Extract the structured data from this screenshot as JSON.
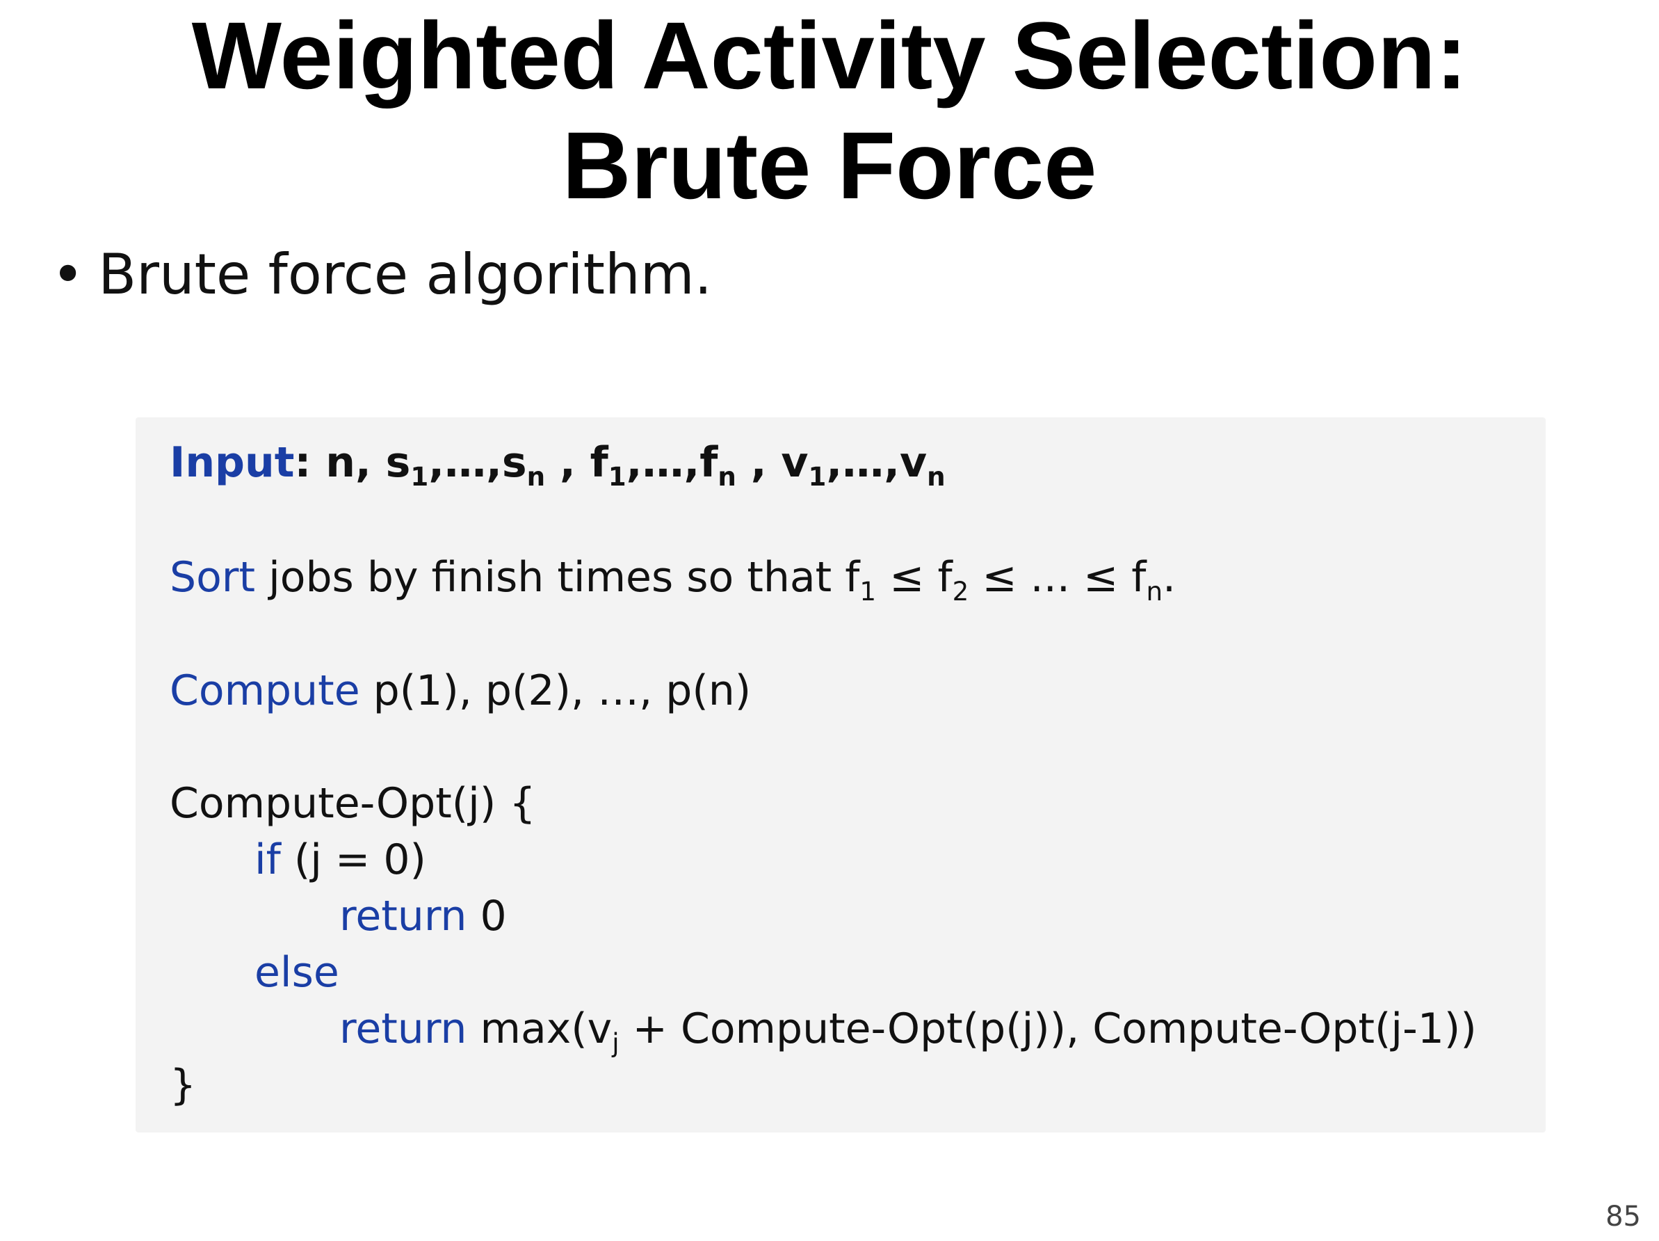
{
  "slide": {
    "title_line1": "Weighted Activity Selection:",
    "title_line2": "Brute Force",
    "bullet": "Brute force algorithm.",
    "page_number": "85"
  },
  "code": {
    "input_kw": "Input",
    "input_colon": ": n, s",
    "input_vars": {
      "s_first_sub": "1",
      "s_mid": ",…,s",
      "s_last_sub": "n",
      "sep1": " , f",
      "f_first_sub": "1",
      "f_mid": ",…,f",
      "f_last_sub": "n",
      "sep2": " , v",
      "v_first_sub": "1",
      "v_mid": ",…,v",
      "v_last_sub": "n"
    },
    "sort_kw": "Sort",
    "sort_text": " jobs by finish times so that f",
    "sort_sub1": "1",
    "sort_mid1": " ≤ f",
    "sort_sub2": "2",
    "sort_mid2": " ≤ ... ≤ f",
    "sort_sub3": "n",
    "sort_end": ".",
    "compute_kw": "Compute",
    "compute_text": " p(1), p(2), …, p(n)",
    "func_header": "Compute-Opt(j) {",
    "if_kw": "if",
    "if_text": " (j = 0)",
    "return_kw": "return",
    "return_zero": " 0",
    "else_kw": "else",
    "return_kw2": "return",
    "max_text1": " max(v",
    "max_sub": "j",
    "max_text2": " + Compute-Opt(p(j)), Compute-Opt(j-1))",
    "close_brace": "}"
  },
  "colors": {
    "keyword": "#1a3ea5",
    "box_background": "#f3f3f3"
  }
}
